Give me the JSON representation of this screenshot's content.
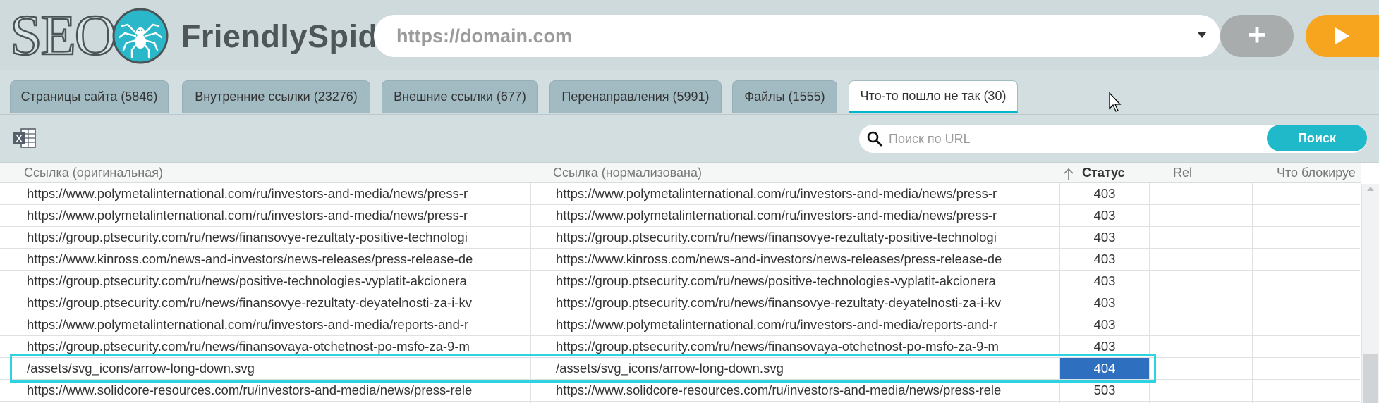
{
  "app": {
    "logo_seo": "SEO",
    "logo_name": "FriendlySpider"
  },
  "url_bar": {
    "placeholder": "https://domain.com",
    "add_label": "+",
    "add_icon": "plus-icon",
    "run_icon": "play-icon",
    "accent_color": "#f7a51f"
  },
  "tabs": [
    {
      "label": "Страницы сайта (5846)",
      "active": false
    },
    {
      "label": "Внутренние ссылки (23276)",
      "active": false
    },
    {
      "label": "Внешние ссылки (677)",
      "active": false
    },
    {
      "label": "Перенаправления (5991)",
      "active": false
    },
    {
      "label": "Файлы (1555)",
      "active": false
    },
    {
      "label": "Что-то пошло не так (30)",
      "active": true
    }
  ],
  "toolbar": {
    "export_icon": "excel-icon",
    "search_placeholder": "Поиск по URL",
    "search_button": "Поиск"
  },
  "table": {
    "columns": [
      "Ссылка (оригинальная)",
      "Ссылка (нормализована)",
      "Статус",
      "Rel",
      "Что блокируе"
    ],
    "sort_column": "Статус",
    "sort_direction": "ascending",
    "rows": [
      {
        "orig": "https://www.polymetalinternational.com/ru/investors-and-media/news/press-r",
        "norm": "https://www.polymetalinternational.com/ru/investors-and-media/news/press-r",
        "status": "403"
      },
      {
        "orig": "https://www.polymetalinternational.com/ru/investors-and-media/news/press-r",
        "norm": "https://www.polymetalinternational.com/ru/investors-and-media/news/press-r",
        "status": "403"
      },
      {
        "orig": "https://group.ptsecurity.com/ru/news/finansovye-rezultaty-positive-technologi",
        "norm": "https://group.ptsecurity.com/ru/news/finansovye-rezultaty-positive-technologi",
        "status": "403"
      },
      {
        "orig": "https://www.kinross.com/news-and-investors/news-releases/press-release-de",
        "norm": "https://www.kinross.com/news-and-investors/news-releases/press-release-de",
        "status": "403"
      },
      {
        "orig": "https://group.ptsecurity.com/ru/news/positive-technologies-vyplatit-akcionera",
        "norm": "https://group.ptsecurity.com/ru/news/positive-technologies-vyplatit-akcionera",
        "status": "403"
      },
      {
        "orig": "https://group.ptsecurity.com/ru/news/finansovye-rezultaty-deyatelnosti-za-i-kv",
        "norm": "https://group.ptsecurity.com/ru/news/finansovye-rezultaty-deyatelnosti-za-i-kv",
        "status": "403"
      },
      {
        "orig": "https://www.polymetalinternational.com/ru/investors-and-media/reports-and-r",
        "norm": "https://www.polymetalinternational.com/ru/investors-and-media/reports-and-r",
        "status": "403"
      },
      {
        "orig": "https://group.ptsecurity.com/ru/news/finansovaya-otchetnost-po-msfo-za-9-m",
        "norm": "https://group.ptsecurity.com/ru/news/finansovaya-otchetnost-po-msfo-za-9-m",
        "status": "403"
      },
      {
        "orig": "/assets/svg_icons/arrow-long-down.svg",
        "norm": "/assets/svg_icons/arrow-long-down.svg",
        "status": "404",
        "selected": true
      },
      {
        "orig": "https://www.solidcore-resources.com/ru/investors-and-media/news/press-rele",
        "norm": "https://www.solidcore-resources.com/ru/investors-and-media/news/press-rele",
        "status": "503"
      }
    ]
  }
}
